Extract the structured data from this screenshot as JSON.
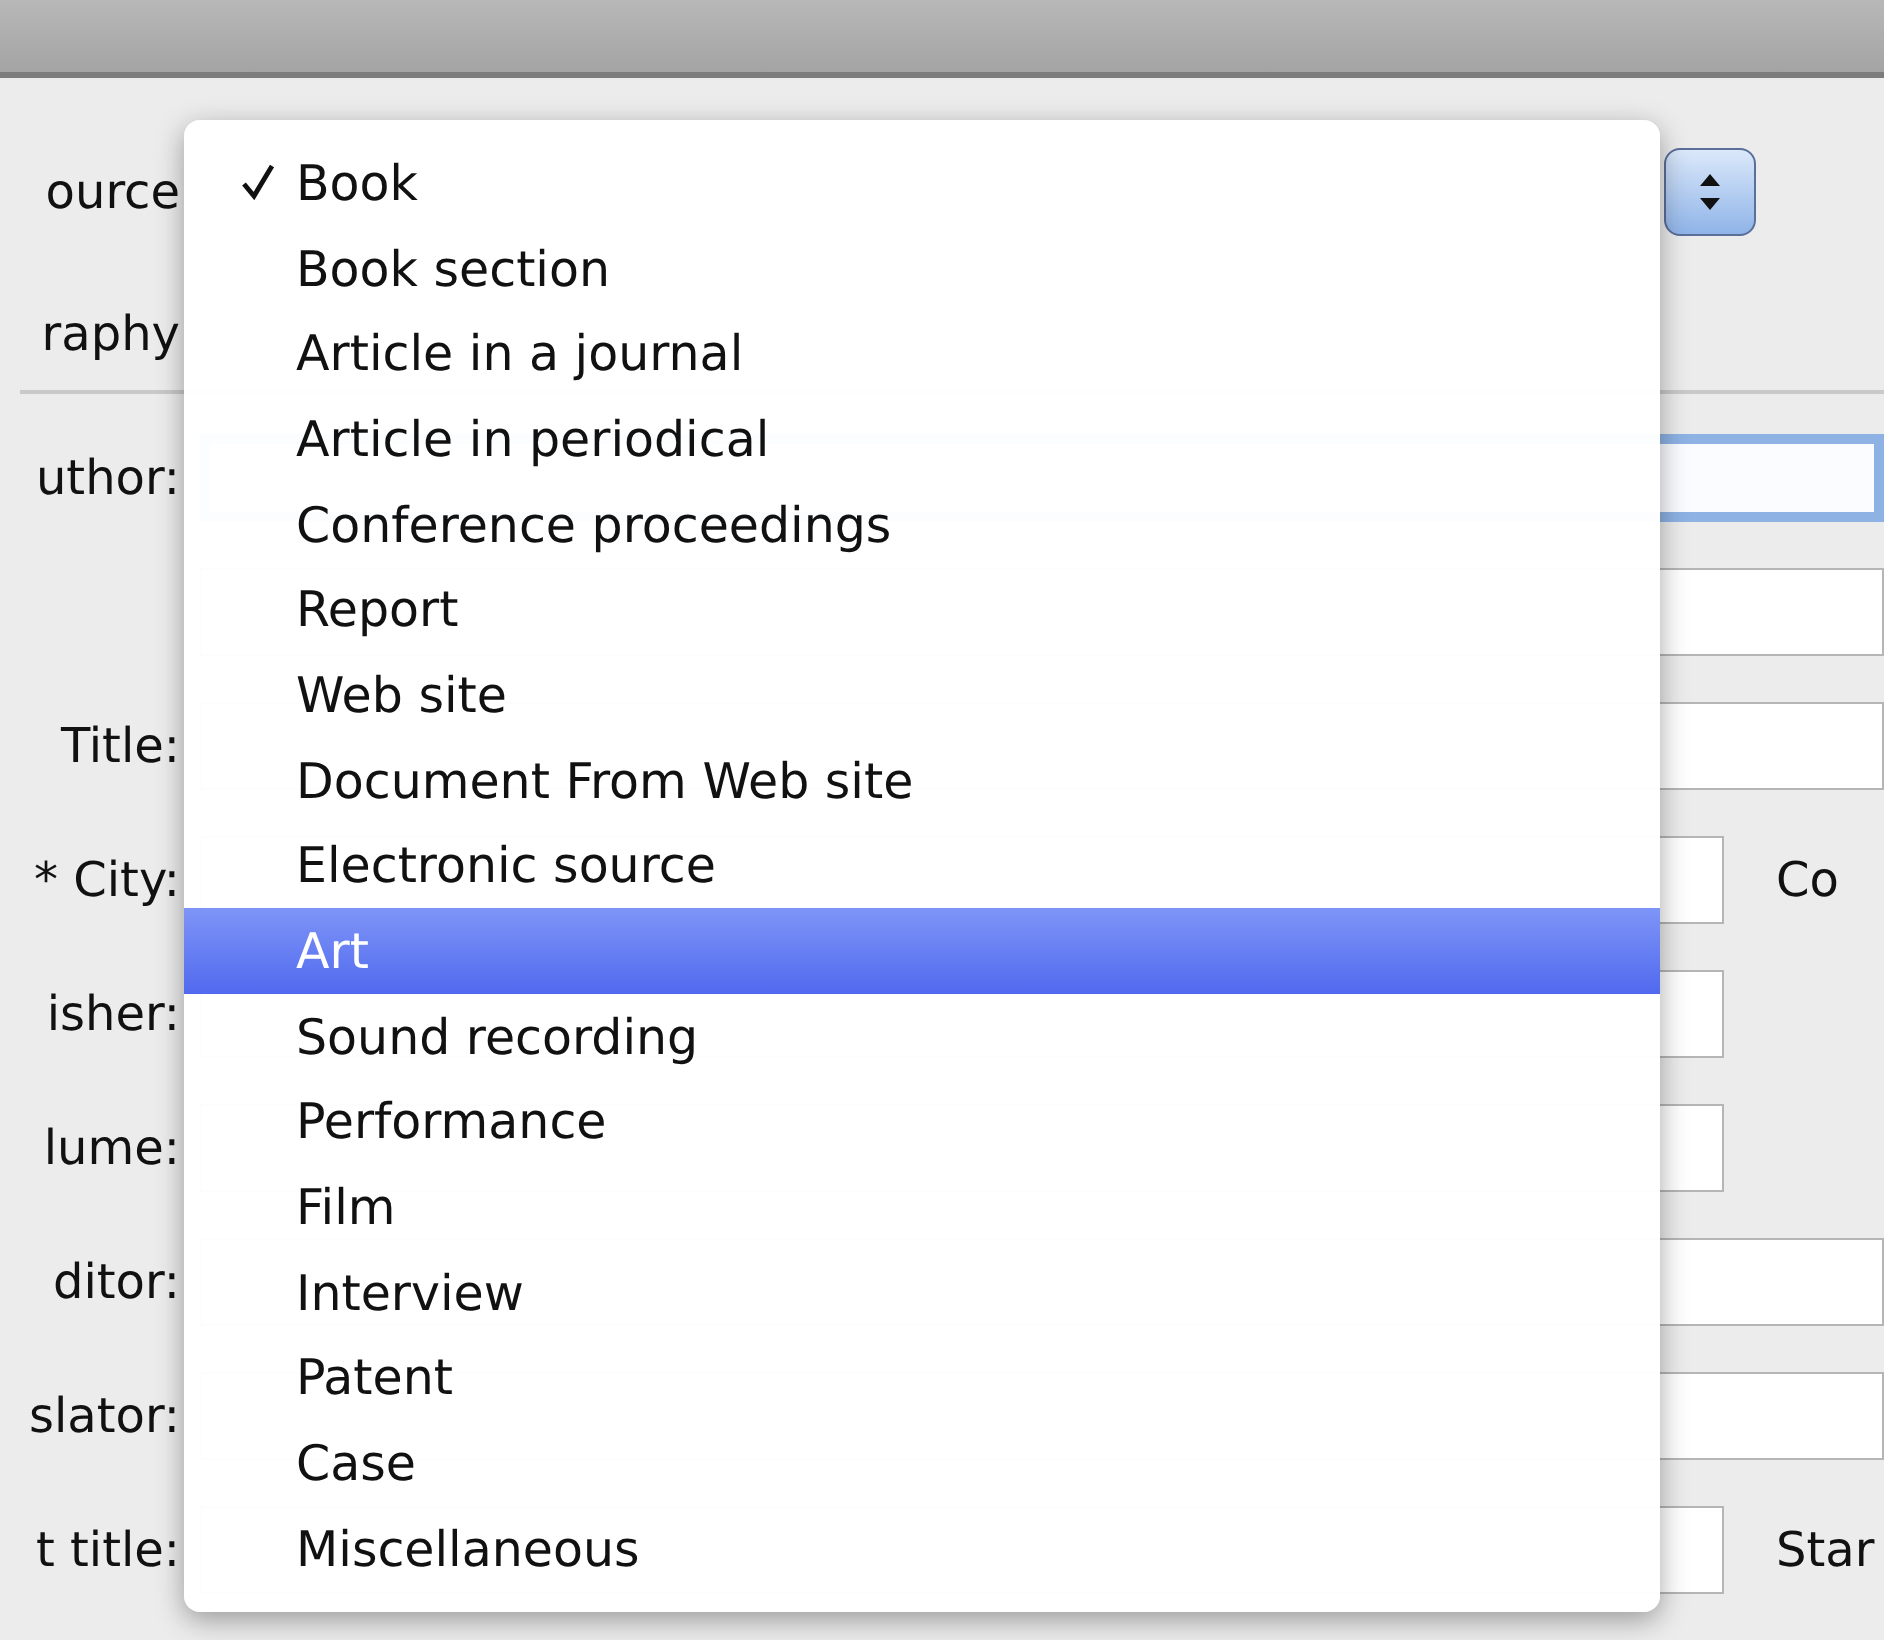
{
  "dialog": {
    "source_label": "ource",
    "section_label": "raphy",
    "rows": [
      {
        "label": "uthor:",
        "kind": "wide",
        "focused": true
      },
      {
        "label": "",
        "kind": "wide",
        "focused": false
      },
      {
        "label": "Title:",
        "kind": "wide",
        "focused": false
      },
      {
        "label": "* City:",
        "kind": "short",
        "focused": false,
        "trailing": "Co"
      },
      {
        "label": "isher:",
        "kind": "short",
        "focused": false
      },
      {
        "label": "lume:",
        "kind": "short",
        "focused": false
      },
      {
        "label": "ditor:",
        "kind": "wide",
        "focused": false
      },
      {
        "label": "slator:",
        "kind": "wide",
        "focused": false
      },
      {
        "label": "t title:",
        "kind": "short",
        "focused": false,
        "trailing": "Star"
      }
    ]
  },
  "menu": {
    "items": [
      {
        "label": "Book",
        "checked": true,
        "selected": false
      },
      {
        "label": "Book section",
        "checked": false,
        "selected": false
      },
      {
        "label": "Article in a journal",
        "checked": false,
        "selected": false
      },
      {
        "label": "Article in periodical",
        "checked": false,
        "selected": false
      },
      {
        "label": "Conference proceedings",
        "checked": false,
        "selected": false
      },
      {
        "label": "Report",
        "checked": false,
        "selected": false
      },
      {
        "label": "Web site",
        "checked": false,
        "selected": false
      },
      {
        "label": "Document From Web site",
        "checked": false,
        "selected": false
      },
      {
        "label": "Electronic source",
        "checked": false,
        "selected": false
      },
      {
        "label": "Art",
        "checked": false,
        "selected": true
      },
      {
        "label": "Sound recording",
        "checked": false,
        "selected": false
      },
      {
        "label": "Performance",
        "checked": false,
        "selected": false
      },
      {
        "label": "Film",
        "checked": false,
        "selected": false
      },
      {
        "label": "Interview",
        "checked": false,
        "selected": false
      },
      {
        "label": "Patent",
        "checked": false,
        "selected": false
      },
      {
        "label": "Case",
        "checked": false,
        "selected": false
      },
      {
        "label": "Miscellaneous",
        "checked": false,
        "selected": false
      }
    ]
  }
}
